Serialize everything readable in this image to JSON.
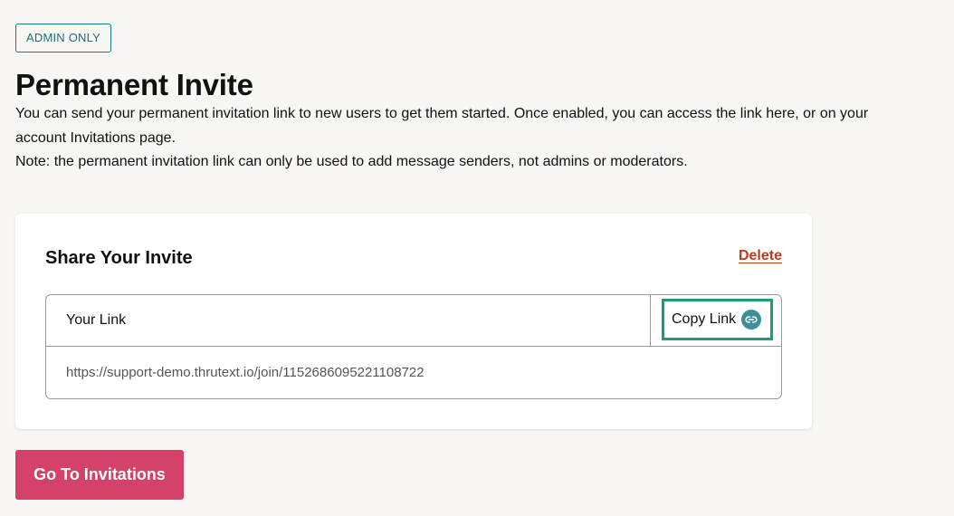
{
  "badge": {
    "label": "ADMIN ONLY"
  },
  "page": {
    "title": "Permanent Invite",
    "description_line1": "You can send your permanent invitation link to new users to get them started. Once enabled, you can access the link here, or on your account Invitations page.",
    "description_note": "Note: the permanent invitation link can only be used to add message senders, not admins or moderators."
  },
  "card": {
    "title": "Share Your Invite",
    "delete_label": "Delete",
    "link_label": "Your Link",
    "copy_label": "Copy Link",
    "copy_icon": "link-icon",
    "url": "https://support-demo.thrutext.io/join/1152686095221108722"
  },
  "actions": {
    "go_label": "Go To Invitations"
  },
  "colors": {
    "background": "#f8f6f3",
    "badge_teal": "#1b7a8a",
    "delete_red": "#c0391b",
    "focus_green": "#13a07b",
    "primary_button": "#d4426a",
    "icon_teal": "#3f8f9a"
  }
}
